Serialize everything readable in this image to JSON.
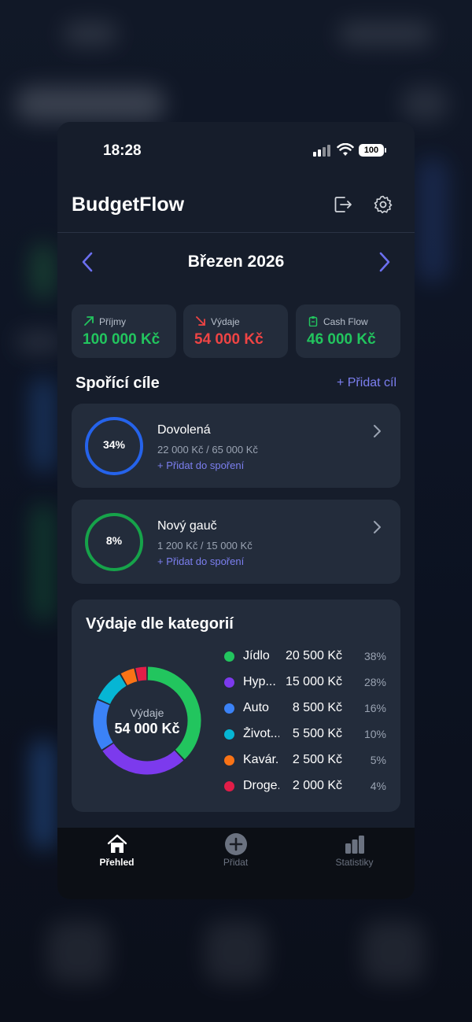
{
  "status_bar": {
    "time": "18:28",
    "battery": "100"
  },
  "header": {
    "title": "BudgetFlow",
    "logout_icon": "logout-icon",
    "settings_icon": "gear-icon"
  },
  "month_nav": {
    "label": "Březen 2026"
  },
  "summary": {
    "income": {
      "label": "Příjmy",
      "value": "100 000 Kč",
      "color": "#22c55e"
    },
    "expense": {
      "label": "Výdaje",
      "value": "54 000 Kč",
      "color": "#ef4444"
    },
    "cashflow": {
      "label": "Cash Flow",
      "value": "46 000 Kč",
      "color": "#22c55e"
    }
  },
  "savings": {
    "title": "Spořící cíle",
    "add_label": "+ Přidat cíl",
    "goals": [
      {
        "name": "Dovolená",
        "percent": "34%",
        "amount": "22 000 Kč / 65 000 Kč",
        "add_label": "+ Přidat do spoření",
        "color": "#2563eb"
      },
      {
        "name": "Nový gauč",
        "percent": "8%",
        "amount": "1 200 Kč / 15 000 Kč",
        "add_label": "+ Přidat do spoření",
        "color": "#16a34a"
      }
    ]
  },
  "categories": {
    "title": "Výdaje dle kategorií",
    "center_label": "Výdaje",
    "center_value": "54 000 Kč",
    "items": [
      {
        "name": "Jídlo",
        "amount": "20 500 Kč",
        "percent": "38%",
        "value": 20500,
        "color": "#22c55e"
      },
      {
        "name": "Hyp...",
        "amount": "15 000 Kč",
        "percent": "28%",
        "value": 15000,
        "color": "#7c3aed"
      },
      {
        "name": "Auto",
        "amount": "8 500 Kč",
        "percent": "16%",
        "value": 8500,
        "color": "#3b82f6"
      },
      {
        "name": "Život...",
        "amount": "5 500 Kč",
        "percent": "10%",
        "value": 5500,
        "color": "#06b6d4"
      },
      {
        "name": "Kavár...",
        "amount": "2 500 Kč",
        "percent": "5%",
        "value": 2500,
        "color": "#f97316"
      },
      {
        "name": "Droge...",
        "amount": "2 000 Kč",
        "percent": "4%",
        "value": 2000,
        "color": "#e11d48"
      }
    ]
  },
  "tabbar": {
    "tabs": [
      {
        "label": "Přehled",
        "icon": "home-icon",
        "active": true
      },
      {
        "label": "Přidat",
        "icon": "plus-circle-icon",
        "active": false
      },
      {
        "label": "Statistiky",
        "icon": "bar-chart-icon",
        "active": false
      }
    ]
  }
}
